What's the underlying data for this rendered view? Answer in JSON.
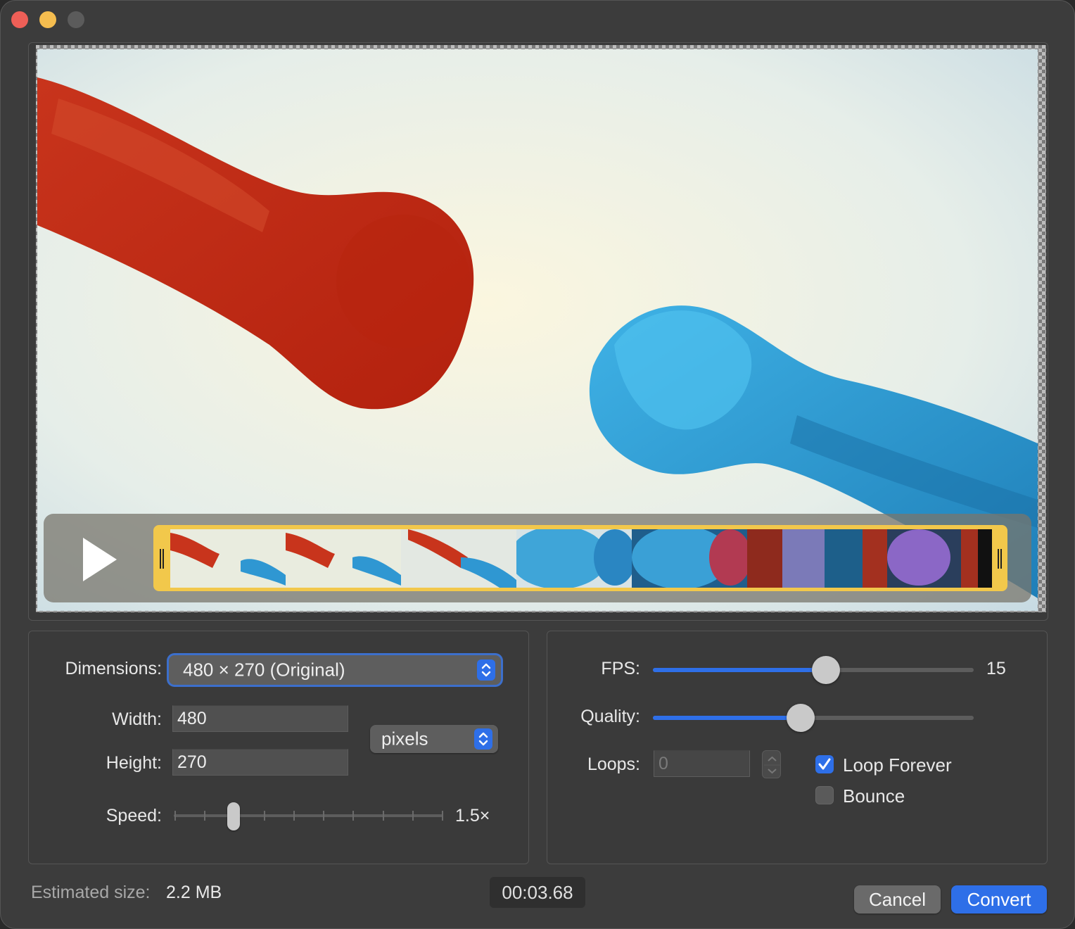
{
  "window": {
    "traffic_lights": [
      "close",
      "minimize",
      "zoom"
    ]
  },
  "timeline": {
    "play_icon": "play-icon",
    "frame_count": 7
  },
  "dimensions": {
    "label": "Dimensions:",
    "selected": "480 × 270 (Original)",
    "width_label": "Width:",
    "width_value": "480",
    "height_label": "Height:",
    "height_value": "270",
    "unit_selected": "pixels",
    "speed_label": "Speed:",
    "speed_value": "1.5×",
    "speed_tick_count": 10,
    "speed_position": 0.22
  },
  "output": {
    "fps_label": "FPS:",
    "fps_value": "15",
    "fps_fraction": 0.54,
    "quality_label": "Quality:",
    "quality_fraction": 0.46,
    "loops_label": "Loops:",
    "loops_value": "0",
    "loop_forever_label": "Loop Forever",
    "loop_forever_checked": true,
    "bounce_label": "Bounce",
    "bounce_checked": false
  },
  "footer": {
    "estimated_label": "Estimated size:",
    "estimated_value": "2.2 MB",
    "duration": "00:03.68",
    "cancel_label": "Cancel",
    "convert_label": "Convert"
  },
  "colors": {
    "accent": "#2e6fe8",
    "window_bg": "#3c3c3c",
    "trim_handle": "#f2c84b",
    "close": "#ee5f57",
    "minimize": "#f5bd4f"
  }
}
